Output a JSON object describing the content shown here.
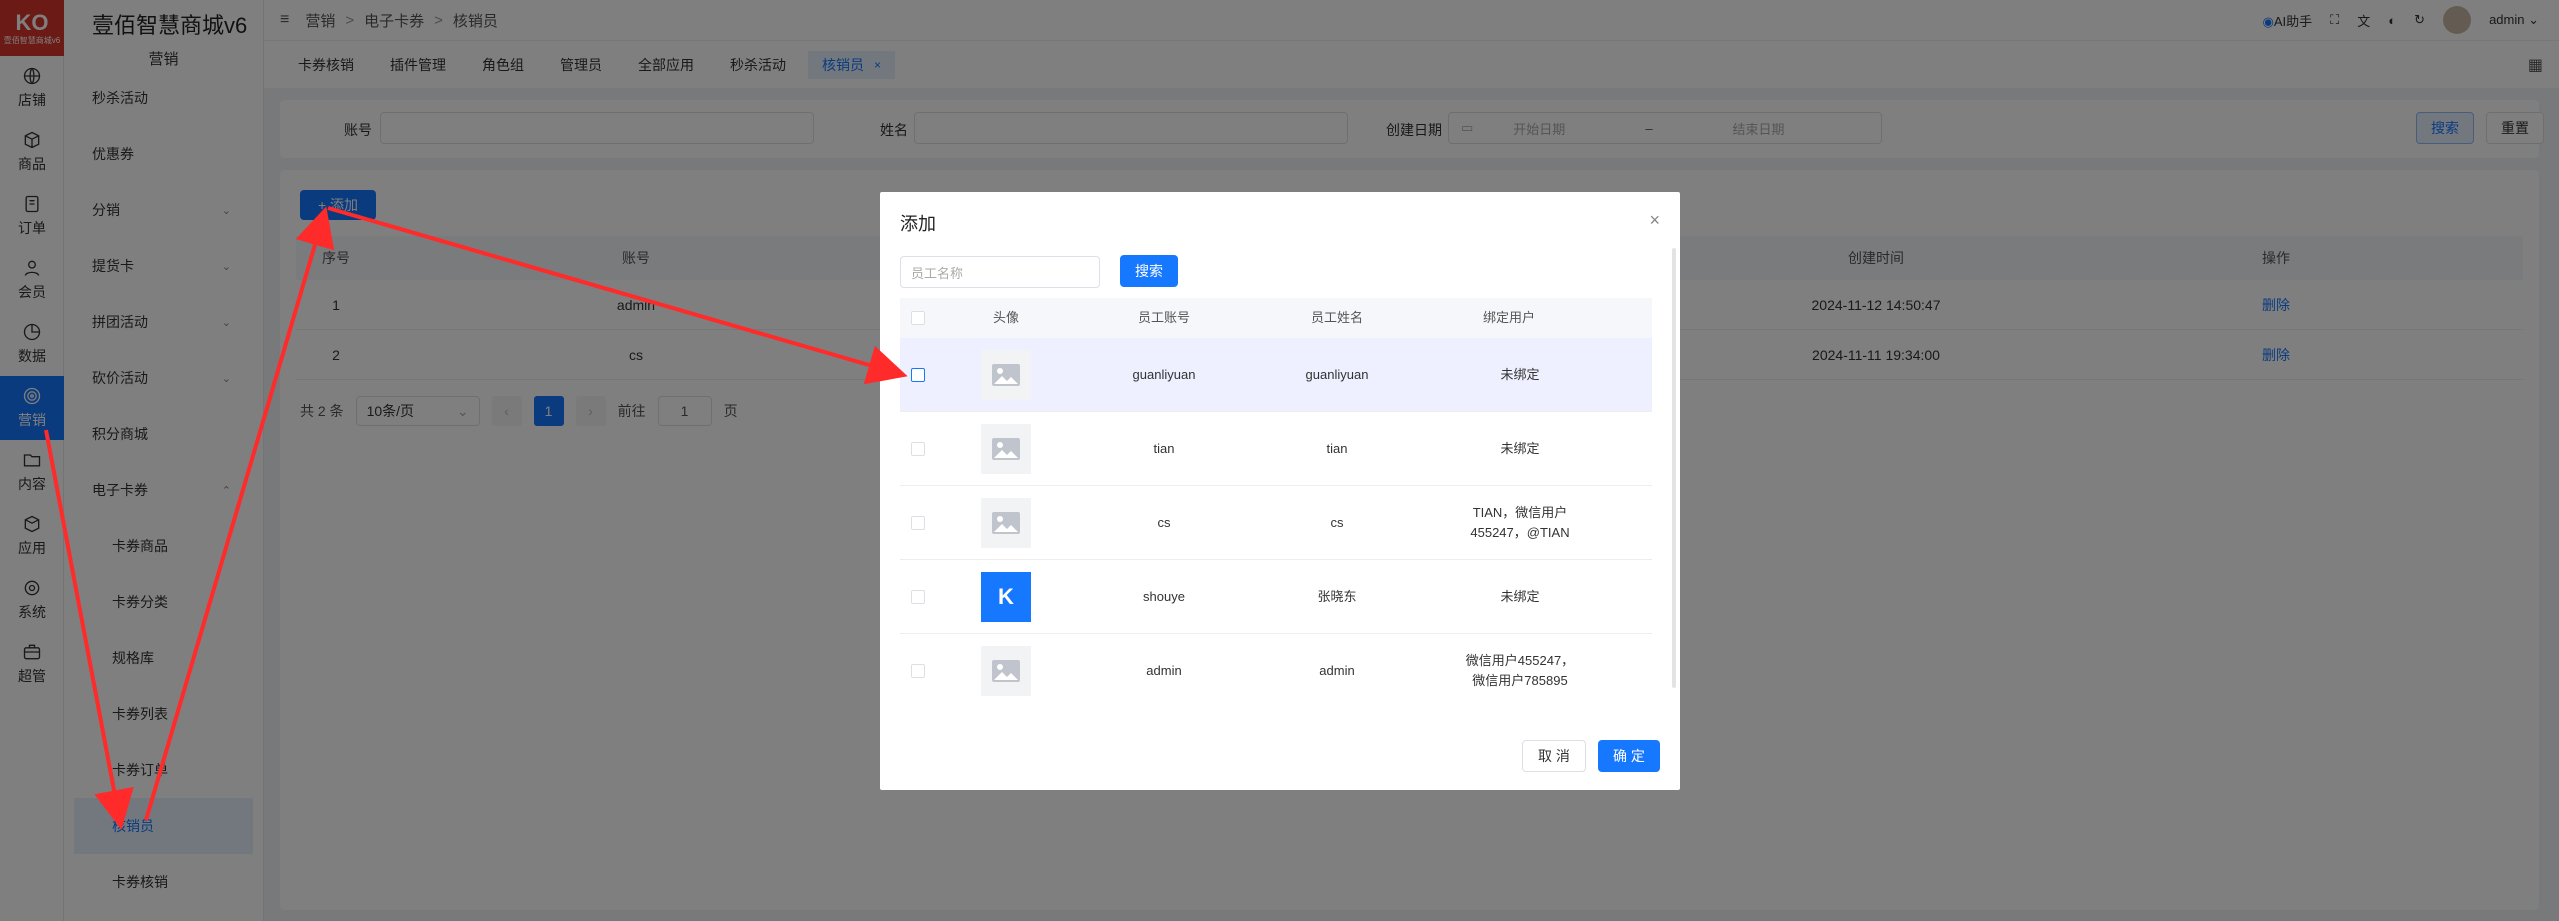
{
  "logo": {
    "mark": "KO",
    "sub": "壹佰智慧商城v6"
  },
  "rail": [
    {
      "icon": "store-icon",
      "label": "店铺"
    },
    {
      "icon": "cube-icon",
      "label": "商品"
    },
    {
      "icon": "order-icon",
      "label": "订单"
    },
    {
      "icon": "user-icon",
      "label": "会员"
    },
    {
      "icon": "chart-icon",
      "label": "数据"
    },
    {
      "icon": "marketing-icon",
      "label": "营销"
    },
    {
      "icon": "folder-icon",
      "label": "内容"
    },
    {
      "icon": "app-icon",
      "label": "应用"
    },
    {
      "icon": "gear-icon",
      "label": "系统"
    },
    {
      "icon": "briefcase-icon",
      "label": "超管"
    }
  ],
  "app_title": "壹佰智慧商城v6",
  "menu_head": "营销",
  "menu": [
    {
      "label": "秒杀活动",
      "chevron": ""
    },
    {
      "label": "优惠券",
      "chevron": ""
    },
    {
      "label": "分销",
      "chevron": "⌄"
    },
    {
      "label": "提货卡",
      "chevron": "⌄"
    },
    {
      "label": "拼团活动",
      "chevron": "⌄"
    },
    {
      "label": "砍价活动",
      "chevron": "⌄"
    },
    {
      "label": "积分商城",
      "chevron": ""
    },
    {
      "label": "电子卡券",
      "chevron": "⌃"
    },
    {
      "label": "卡券商品",
      "chevron": ""
    },
    {
      "label": "卡券分类",
      "chevron": ""
    },
    {
      "label": "规格库",
      "chevron": ""
    },
    {
      "label": "卡券列表",
      "chevron": ""
    },
    {
      "label": "卡券订单",
      "chevron": ""
    },
    {
      "label": "核销员",
      "chevron": ""
    },
    {
      "label": "卡券核销",
      "chevron": ""
    }
  ],
  "breadcrumb": [
    "营销",
    "电子卡券",
    "核销员"
  ],
  "topbar": {
    "ai": "AI助手",
    "user": "admin"
  },
  "tabs": [
    "卡券核销",
    "插件管理",
    "角色组",
    "管理员",
    "全部应用",
    "秒杀活动",
    "核销员"
  ],
  "filter": {
    "account_label": "账号",
    "name_label": "姓名",
    "date_label": "创建日期",
    "start_placeholder": "开始日期",
    "date_sep": "–",
    "end_placeholder": "结束日期",
    "search": "搜索",
    "reset": "重置"
  },
  "list": {
    "add": "+ 添加",
    "headers": [
      "序号",
      "账号",
      "创建时间",
      "操作"
    ],
    "rows": [
      {
        "no": "1",
        "account": "admin",
        "created": "2024-11-12 14:50:47",
        "action": "删除"
      },
      {
        "no": "2",
        "account": "cs",
        "created": "2024-11-11 19:34:00",
        "action": "删除"
      }
    ],
    "total": "共 2 条",
    "page_size": "10条/页",
    "prev": "‹",
    "page": "1",
    "next": "›",
    "goto": "前往",
    "goto_value": "1",
    "page_unit": "页"
  },
  "dialog": {
    "title": "添加",
    "close": "×",
    "search_placeholder": "员工名称",
    "search": "搜索",
    "headers": [
      "头像",
      "员工账号",
      "员工姓名",
      "绑定用户"
    ],
    "rows": [
      {
        "avatar": "placeholder",
        "account": "guanliyuan",
        "name": "guanliyuan",
        "bound": "未绑定"
      },
      {
        "avatar": "placeholder",
        "account": "tian",
        "name": "tian",
        "bound": "未绑定"
      },
      {
        "avatar": "placeholder",
        "account": "cs",
        "name": "cs",
        "bound": "TIAN，微信用户455247，@TIAN"
      },
      {
        "avatar": "logo",
        "account": "shouye",
        "name": "张晓东",
        "bound": "未绑定"
      },
      {
        "avatar": "placeholder",
        "account": "admin",
        "name": "admin",
        "bound": "微信用户455247，微信用户785895"
      }
    ],
    "cancel": "取 消",
    "ok": "确 定"
  },
  "colors": {
    "primary": "#1677ff",
    "brand": "#d9342b",
    "annotation": "#ff2a2a"
  }
}
